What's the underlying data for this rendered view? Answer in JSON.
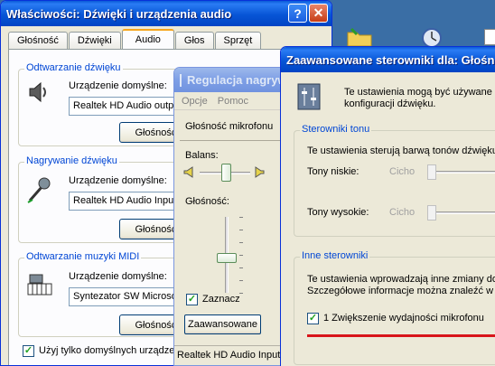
{
  "main": {
    "title": "Właściwości: Dźwięki i urządzenia audio",
    "tabs": [
      "Głośność",
      "Dźwięki",
      "Audio",
      "Głos",
      "Sprzęt"
    ],
    "active_tab": 2,
    "playback": {
      "legend": "Odtwarzanie dźwięku",
      "device_label": "Urządzenie domyślne:",
      "device_value": "Realtek HD Audio output",
      "button": "Głośność..."
    },
    "recording": {
      "legend": "Nagrywanie dźwięku",
      "device_label": "Urządzenie domyślne:",
      "device_value": "Realtek HD Audio Input",
      "button": "Głośność..."
    },
    "midi": {
      "legend": "Odtwarzanie muzyki MIDI",
      "device_label": "Urządzenie domyślne:",
      "device_value": "Syntezator SW Microsoft GS",
      "button": "Głośność..."
    },
    "default_only": {
      "label": "Użyj tylko domyślnych urządzeń",
      "checked": true
    }
  },
  "volume": {
    "title": "Regulacja nagrywania",
    "menu": [
      "Opcje",
      "Pomoc"
    ],
    "channel": "Głośność mikrofonu",
    "balance_label": "Balans:",
    "volume_label": "Głośność:",
    "volume_level": 0.45,
    "mute_label": "Zaznacz",
    "mute_checked": true,
    "advanced_button": "Zaawansowane",
    "status": "Realtek HD Audio Input"
  },
  "advanced": {
    "title": "Zaawansowane sterowniki dla: Głośność mikrofonu",
    "intro": [
      "Te ustawienia mogą być używane do wprowadzenia zmian w",
      "konfiguracji dźwięku."
    ],
    "tone": {
      "legend": "Sterowniki tonu",
      "desc": "Te ustawienia sterują barwą tonów dźwięku.",
      "bass_label": "Tony niskie:",
      "treble_label": "Tony wysokie:",
      "low_word": "Cicho"
    },
    "other": {
      "legend": "Inne sterowniki",
      "desc": [
        "Te ustawienia wprowadzają inne zmiany do brzmienia.",
        "Szczegółowe informacje można znaleźć w dokumentacji."
      ],
      "boost_label": "1  Zwiększenie wydajności mikrofonu",
      "boost_checked": true
    }
  },
  "colors": {
    "accent": "#0046d5",
    "titlebar": "#0755d6",
    "highlight": "#d8151a"
  }
}
